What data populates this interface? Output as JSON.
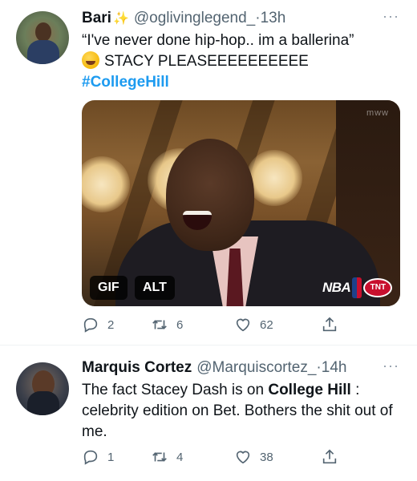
{
  "tweets": [
    {
      "name": "Bari",
      "handle": "@oglivinglegend_",
      "separator": "·",
      "time": "13h",
      "more": "···",
      "line1": "“I've never done hip-hop.. im a ballerina”",
      "line2": "STACY PLEASEEEEEEEEEE",
      "hashtag": "#CollegeHill",
      "media": {
        "gif_label": "GIF",
        "alt_label": "ALT",
        "watermark": "mww",
        "network_logo": "NBA",
        "tnt_logo": "TNT"
      },
      "stats": {
        "replies": "2",
        "retweets": "6",
        "likes": "62"
      }
    },
    {
      "name": "Marquis Cortez",
      "handle": "@Marquiscortez_",
      "separator": "·",
      "time": "14h",
      "more": "···",
      "text_part1": "The fact Stacey Dash is on ",
      "text_bold": "College Hill",
      "text_part2": " : celebrity edition on Bet. Bothers the shit out of me.",
      "stats": {
        "replies": "1",
        "retweets": "4",
        "likes": "38"
      }
    }
  ],
  "icons": {
    "reply": "reply-icon",
    "retweet": "retweet-icon",
    "like": "heart-icon",
    "share": "share-icon",
    "sparkle": "sparkles-emoji",
    "laugh": "tears-of-joy-emoji"
  },
  "colors": {
    "link": "#1d9bf0",
    "secondary_text": "#536471",
    "primary_text": "#0f1419"
  }
}
